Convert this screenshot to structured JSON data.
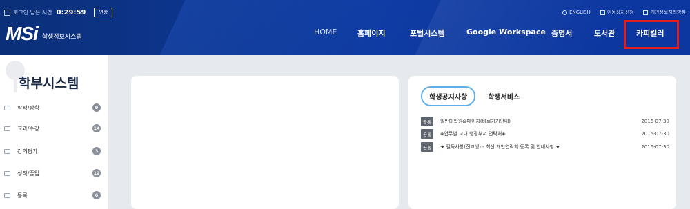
{
  "topbar": {
    "session_label": "로그인 남은 시간",
    "session_time": "0:29:59",
    "extend_label": "연장",
    "util_links": [
      "ENGLISH",
      "이동장치신청",
      "개인정보처리방침"
    ]
  },
  "logo": {
    "mark": "MSi",
    "subtitle": "학생정보시스템"
  },
  "nav": {
    "items": [
      "HOME",
      "홈페이지",
      "포털시스템",
      "Google Workspace",
      "증명서",
      "도서관",
      "카피킬러"
    ],
    "highlight_color": "#e01d1d"
  },
  "sidebar": {
    "title": "학부시스템",
    "items": [
      {
        "label": "학적/장학",
        "count": "9"
      },
      {
        "label": "교과/수강",
        "count": "14"
      },
      {
        "label": "강의평가",
        "count": "3"
      },
      {
        "label": "성적/졸업",
        "count": "12"
      },
      {
        "label": "등록",
        "count": "6"
      }
    ]
  },
  "notices": {
    "tabs": [
      "학생공지사항",
      "학생서비스"
    ],
    "items": [
      {
        "tag": "공통",
        "title": "일반대학원홈페이지(바로가기안내)",
        "date": "2016-07-30"
      },
      {
        "tag": "공통",
        "title": "◈업무별 교내 행정부서 연락처◈",
        "date": "2016-07-30"
      },
      {
        "tag": "공통",
        "title": "★ 필독사항(전교생) - 최신 개인연락처 등록 및 안내사항 ★",
        "date": "2016-07-30"
      }
    ]
  },
  "colors": {
    "header": "#0d3aa1",
    "accent": "#5fb0e8",
    "badge": "#8a8f98"
  }
}
